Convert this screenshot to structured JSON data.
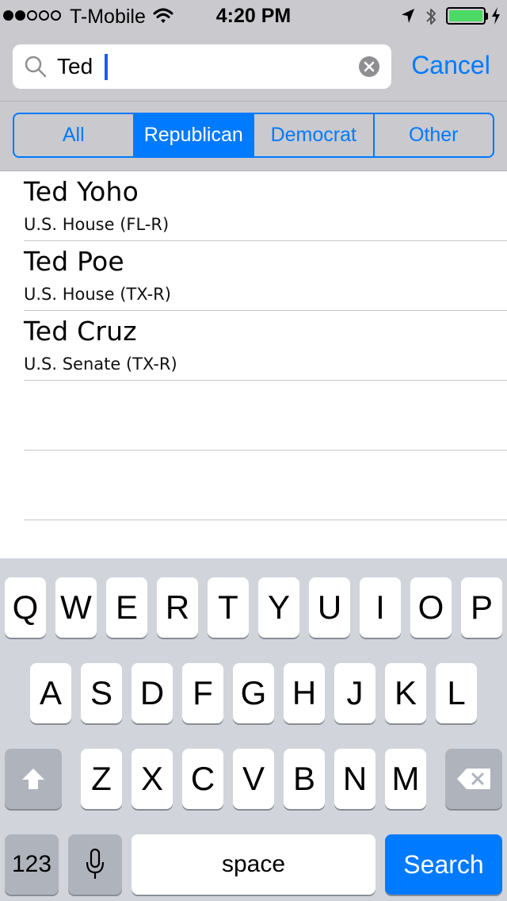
{
  "status_bar": {
    "carrier": "T-Mobile",
    "time": "4:20 PM",
    "signal_bars_filled": 2,
    "signal_bars_total": 5,
    "battery_level": 1.0,
    "colors": {
      "battery": "#4cd964"
    }
  },
  "search": {
    "query": "Ted",
    "cancel_label": "Cancel"
  },
  "filter": {
    "segments": [
      "All",
      "Republican",
      "Democrat",
      "Other"
    ],
    "selected": "Republican"
  },
  "results": [
    {
      "name": "Ted Yoho",
      "subtitle": "U.S. House (FL-R)"
    },
    {
      "name": "Ted Poe",
      "subtitle": "U.S. House (TX-R)"
    },
    {
      "name": "Ted Cruz",
      "subtitle": "U.S. Senate (TX-R)"
    }
  ],
  "keyboard": {
    "row1": [
      "Q",
      "W",
      "E",
      "R",
      "T",
      "Y",
      "U",
      "I",
      "O",
      "P"
    ],
    "row2": [
      "A",
      "S",
      "D",
      "F",
      "G",
      "H",
      "J",
      "K",
      "L"
    ],
    "row3": [
      "Z",
      "X",
      "C",
      "V",
      "B",
      "N",
      "M"
    ],
    "numbers_label": "123",
    "space_label": "space",
    "search_label": "Search"
  },
  "colors": {
    "accent": "#007aff",
    "header_bg": "#c9c9ce",
    "keyboard_bg": "#d1d5db"
  }
}
